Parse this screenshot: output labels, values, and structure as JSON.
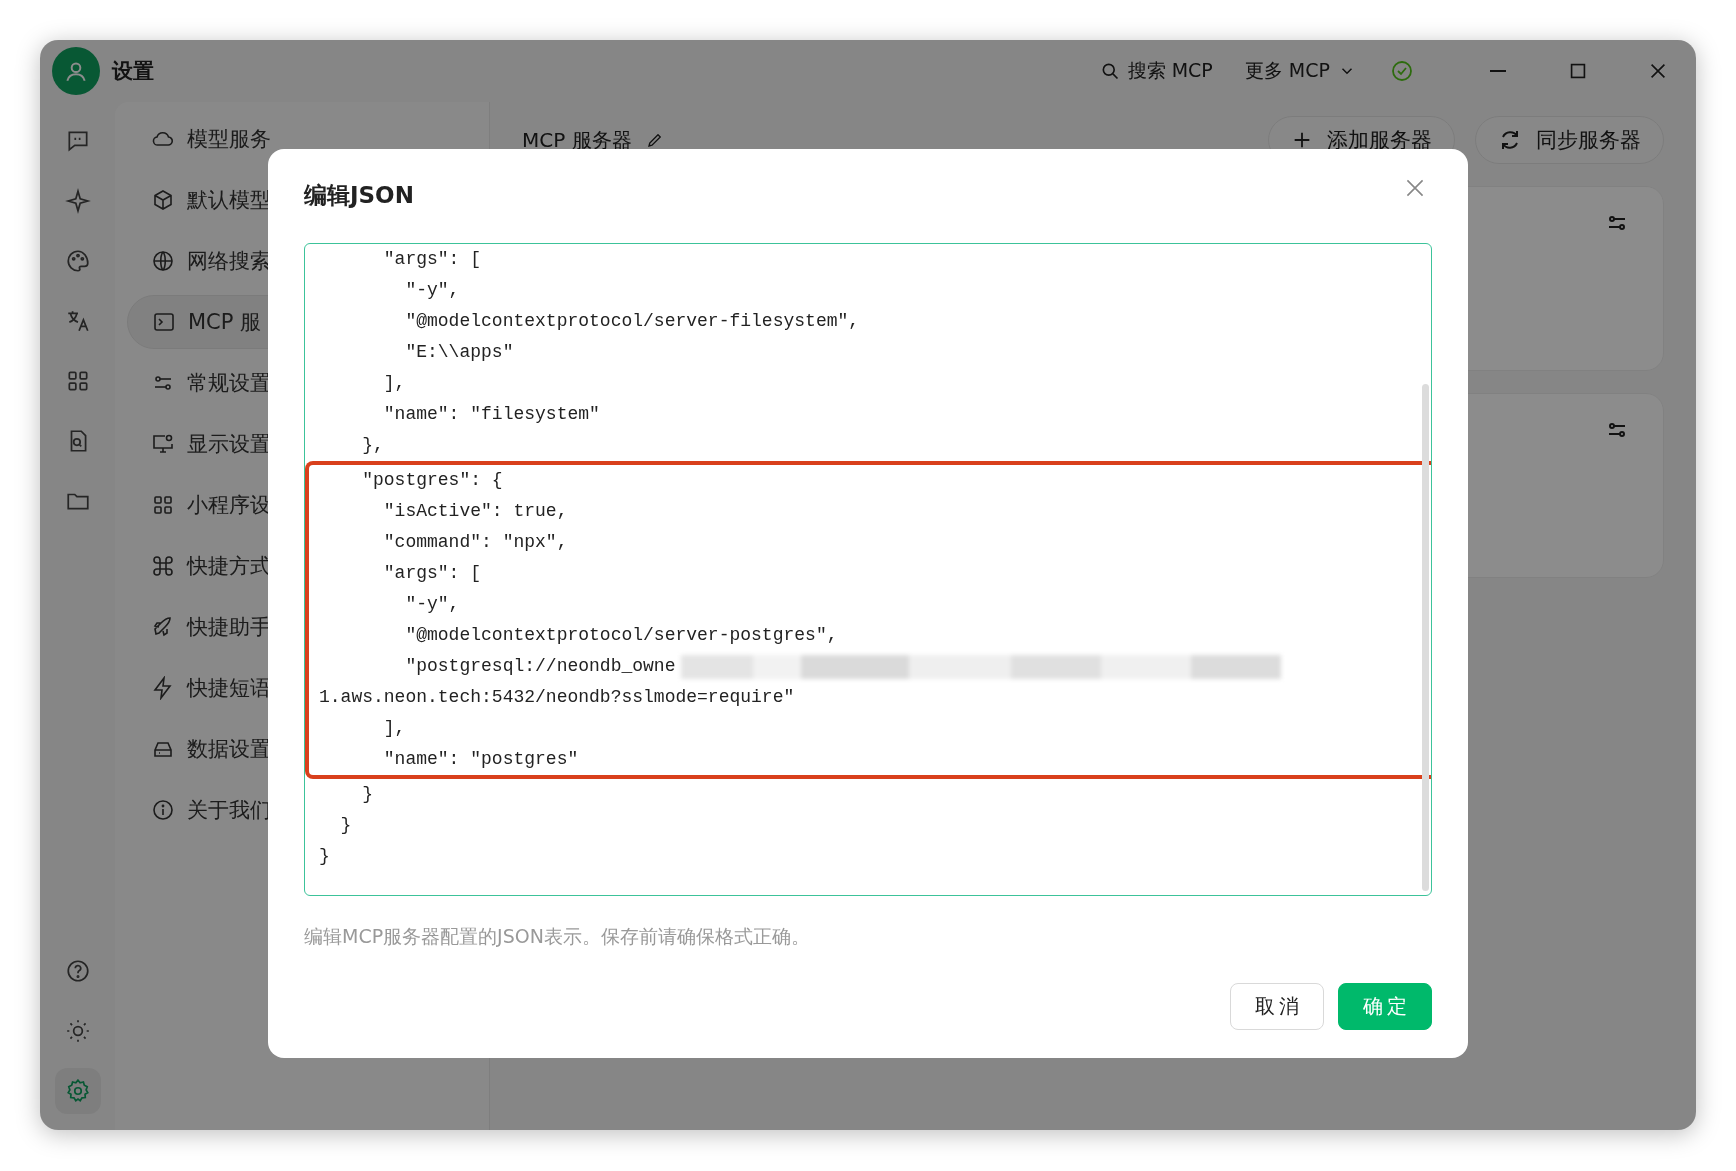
{
  "window": {
    "title": "设置"
  },
  "top_bar": {
    "search_label": "搜索 MCP",
    "more_label": "更多 MCP"
  },
  "rail_items": [
    {
      "selected": false
    },
    {
      "selected": false
    },
    {
      "selected": false
    },
    {
      "selected": false
    },
    {
      "selected": false
    },
    {
      "selected": false
    },
    {
      "selected": false
    }
  ],
  "rail_bottom": [
    {
      "selected": false
    },
    {
      "selected": false
    },
    {
      "selected": true
    }
  ],
  "nav": {
    "items": [
      {
        "label": "模型服务",
        "selected": false
      },
      {
        "label": "默认模型",
        "selected": false
      },
      {
        "label": "网络搜索",
        "selected": false
      },
      {
        "label": "MCP 服",
        "selected": true
      },
      {
        "label": "常规设置",
        "selected": false
      },
      {
        "label": "显示设置",
        "selected": false
      },
      {
        "label": "小程序设",
        "selected": false
      },
      {
        "label": "快捷方式",
        "selected": false
      },
      {
        "label": "快捷助手",
        "selected": false
      },
      {
        "label": "快捷短语",
        "selected": false
      },
      {
        "label": "数据设置",
        "selected": false
      },
      {
        "label": "关于我们",
        "selected": false
      }
    ]
  },
  "content": {
    "title": "MCP 服务器",
    "add_button": "添加服务器",
    "sync_button": "同步服务器"
  },
  "dialog": {
    "title": "编辑JSON",
    "lines": [
      {
        "kind": "code",
        "text": "      \"args\": [",
        "highlighted": false
      },
      {
        "kind": "code",
        "text": "        \"-y\",",
        "highlighted": false
      },
      {
        "kind": "code",
        "text": "        \"@modelcontextprotocol/server-filesystem\",",
        "highlighted": false
      },
      {
        "kind": "code",
        "text": "        \"E:\\\\apps\"",
        "highlighted": false
      },
      {
        "kind": "code",
        "text": "      ],",
        "highlighted": false
      },
      {
        "kind": "code",
        "text": "      \"name\": \"filesystem\"",
        "highlighted": false
      },
      {
        "kind": "code",
        "text": "    },",
        "highlighted": false
      },
      {
        "kind": "code",
        "text": "    \"postgres\": {",
        "highlighted": true
      },
      {
        "kind": "code",
        "text": "      \"isActive\": true,",
        "highlighted": true
      },
      {
        "kind": "code",
        "text": "      \"command\": \"npx\",",
        "highlighted": true
      },
      {
        "kind": "code",
        "text": "      \"args\": [",
        "highlighted": true
      },
      {
        "kind": "code",
        "text": "        \"-y\",",
        "highlighted": true
      },
      {
        "kind": "code",
        "text": "        \"@modelcontextprotocol/server-postgres\",",
        "highlighted": true
      },
      {
        "kind": "redacted",
        "text": "        \"postgresql://neondb_owne",
        "highlighted": true
      },
      {
        "kind": "code",
        "text": "1.aws.neon.tech:5432/neondb?sslmode=require\"",
        "highlighted": true
      },
      {
        "kind": "code",
        "text": "      ],",
        "highlighted": true
      },
      {
        "kind": "code",
        "text": "      \"name\": \"postgres\"",
        "highlighted": true
      },
      {
        "kind": "code",
        "text": "    }",
        "highlighted": false
      },
      {
        "kind": "code",
        "text": "  }",
        "highlighted": false
      },
      {
        "kind": "code",
        "text": "}",
        "highlighted": false
      }
    ],
    "hint": "编辑MCP服务器配置的JSON表示。保存前请确保格式正确。",
    "cancel": "取消",
    "confirm": "确定"
  }
}
